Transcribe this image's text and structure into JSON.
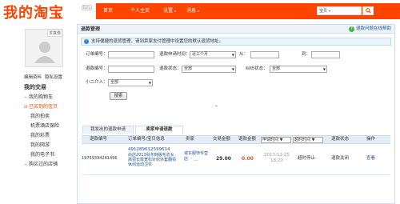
{
  "header": {
    "logo": "我的淘宝",
    "beta": "Beta",
    "nav": [
      "首页",
      "个人主页",
      "设置",
      "消息"
    ],
    "search_scope": "宝贝"
  },
  "sidebar": {
    "avatar_tag": "求真像",
    "links": [
      "编辑资料",
      "隐私设置"
    ],
    "section_title": "我的交易",
    "items": [
      {
        "label": "我的购物车",
        "type": "collapsed"
      },
      {
        "label": "已买到的宝贝",
        "type": "open"
      },
      {
        "label": "我的拍卖",
        "type": "sub"
      },
      {
        "label": "机票酒店保险",
        "type": "sub"
      },
      {
        "label": "我的彩票",
        "type": "sub"
      },
      {
        "label": "我的网游",
        "type": "sub"
      },
      {
        "label": "我的电子书",
        "type": "sub"
      },
      {
        "label": "购买过的店铺",
        "type": "collapsed"
      }
    ]
  },
  "main": {
    "title": "退款管理",
    "help": "退款问题在线帮助",
    "notice": "支持便捷的退货管理，请到卖家支付管理中设置您的默认退货地址。",
    "form": {
      "order_no": "订单编号：",
      "apply_time": "退款申请时间：",
      "apply_time_value": "近三个月",
      "from": "从：",
      "to": "到：",
      "refund_no": "退款编号：",
      "refund_status": "退款状态：",
      "refund_status_value": "全部",
      "dispute_status": "纠纷状态：",
      "dispute_status_value": "全部",
      "xiaoer": "小二介入：",
      "xiaoer_value": "全部",
      "search_button": "搜索"
    },
    "tabs": [
      "我发出的退款申请",
      "卖家申请退款"
    ],
    "table": {
      "headers": {
        "refund_no": "退款编号",
        "order_no": "订单编号/宝贝信息",
        "seller": "卖家",
        "deal_amount": "交易金额",
        "refund_amount": "退款金额",
        "apply_time": "申请时间",
        "timeout": "超时时间",
        "status": "退款状态",
        "op": "操作"
      },
      "rows": [
        {
          "refund_no": "19759394241496",
          "order_no": "491289612599614",
          "item": "尚店2013秋冬韩版毛衣女高领长款宽松针织外套翻领休闲运动卫衣",
          "seller": "城东服饰专营店",
          "seller_sub": "—",
          "deal_amount": "29.00",
          "refund_amount": "0.00",
          "apply_date": "2013-12-25",
          "apply_clock": "18:20",
          "timeout": "超时停止",
          "status": "退款关闭",
          "op": "查看"
        }
      ]
    }
  },
  "colors": {
    "brand": "#ff4400",
    "link": "#1e5494",
    "panel_head": "#eef3f9",
    "table_head": "#e3edf7"
  }
}
